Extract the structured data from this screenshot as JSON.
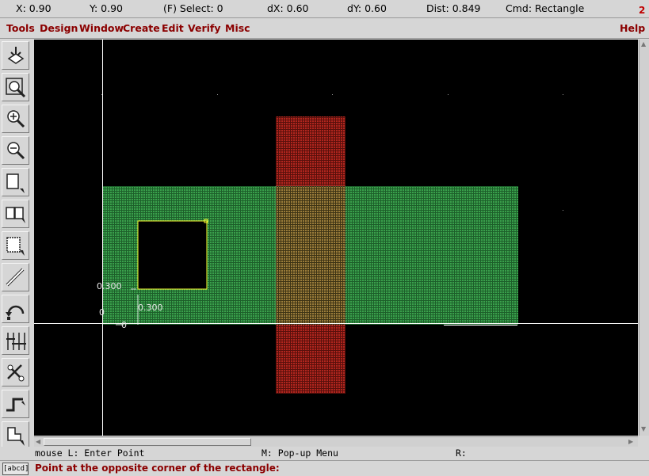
{
  "status": {
    "x": "X:  0.90",
    "y": "Y:  0.90",
    "select": "(F) Select: 0",
    "dx": "dX:  0.60",
    "dy": "dY:  0.60",
    "dist": "Dist: 0.849",
    "cmd": "Cmd: Rectangle",
    "window_number": "2"
  },
  "menu": {
    "items": [
      "Tools",
      "Design",
      "Window",
      "Create",
      "Edit",
      "Verify",
      "Misc"
    ],
    "help": "Help"
  },
  "toolbar": {
    "tools": [
      "save-icon",
      "zoom-fit-icon",
      "zoom-in-icon",
      "zoom-out-icon",
      "stretch-icon",
      "copy-icon",
      "move-icon",
      "ruler-icon",
      "undo-icon",
      "path-icon",
      "property-icon",
      "wire-icon",
      "select-icon"
    ]
  },
  "canvas": {
    "colors": {
      "background": "#000000",
      "green_layer": "#2e8b3e",
      "red_layer": "#a0221b",
      "highlight": "#ffff33",
      "axis": "#ffffff"
    },
    "dimensions": {
      "width_label": "0.300",
      "height_label": "0.300",
      "origin_x": "0",
      "origin_y": "0"
    }
  },
  "mouse": {
    "left": "mouse L: Enter Point",
    "middle": "M: Pop-up Menu",
    "right": "R:"
  },
  "prompt": {
    "box": "[abcd]",
    "text": "Point at the opposite corner of the rectangle:"
  }
}
